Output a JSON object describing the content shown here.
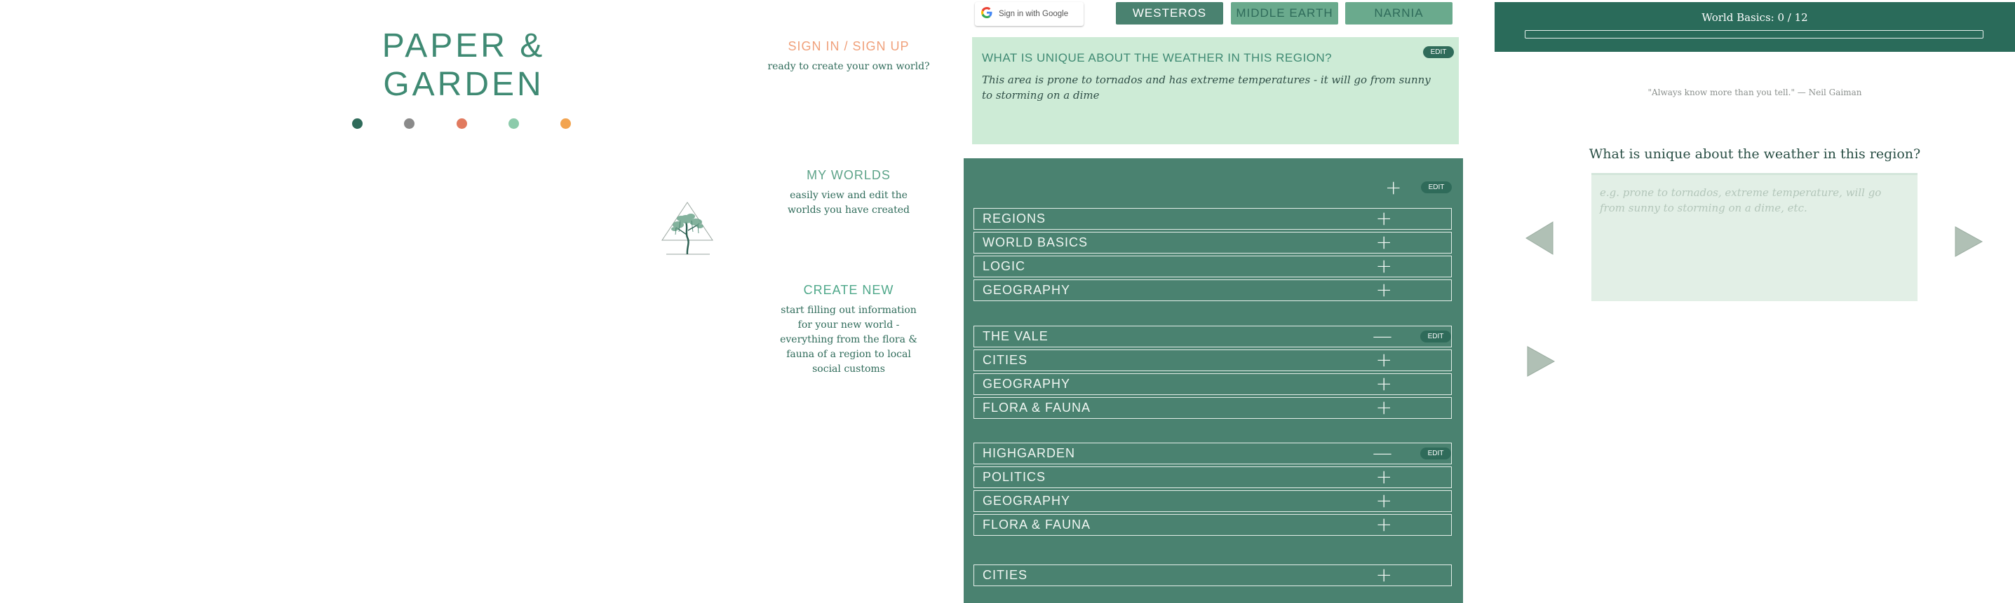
{
  "brand": {
    "title": "PAPER & GARDEN",
    "palette": [
      "#2f6b5a",
      "#8a8a8a",
      "#e17a5f",
      "#8ccbab",
      "#f2a450"
    ]
  },
  "landing": {
    "sign_in": {
      "heading": "SIGN IN / SIGN UP",
      "text": "ready to create your own world?",
      "color": "#f0a07a"
    },
    "my_worlds": {
      "heading": "MY WORLDS",
      "text": "easily view and edit the worlds you have created",
      "color": "#5da389"
    },
    "create_new": {
      "heading": "CREATE NEW",
      "text": "start filling out information for your new world - everything from the flora & fauna of a region to local social customs",
      "color": "#4fa88a"
    }
  },
  "editor": {
    "google_button": "Sign in with Google",
    "world_tabs": [
      {
        "label": "WESTEROS",
        "bg": "#4a8270",
        "color": "#ffffff"
      },
      {
        "label": "MIDDLE EARTH",
        "bg": "#6aaa8d",
        "color": "#2f6b5a"
      },
      {
        "label": "NARNIA",
        "bg": "#6aaa8d",
        "color": "#2f6b5a"
      }
    ],
    "question_card": {
      "question": "WHAT IS UNIQUE ABOUT THE WEATHER IN THIS REGION?",
      "answer": "This area is prone to tornados and has extreme temperatures - it will go from sunny to storming on a dime",
      "edit_label": "EDIT"
    },
    "edit_label": "EDIT",
    "top_toggle": "+",
    "sections": [
      {
        "label": "REGIONS",
        "toggle": "+"
      },
      {
        "label": "WORLD BASICS",
        "toggle": "+"
      },
      {
        "label": "LOGIC",
        "toggle": "+"
      },
      {
        "label": "GEOGRAPHY",
        "toggle": "+"
      },
      {
        "label": "THE VALE",
        "toggle": "—"
      },
      {
        "label": "CITIES",
        "toggle": "+"
      },
      {
        "label": "GEOGRAPHY",
        "toggle": "+"
      },
      {
        "label": "FLORA & FAUNA",
        "toggle": "+"
      },
      {
        "label": "HIGHGARDEN",
        "toggle": "—"
      },
      {
        "label": "POLITICS",
        "toggle": "+"
      },
      {
        "label": "GEOGRAPHY",
        "toggle": "+"
      },
      {
        "label": "FLORA & FAUNA",
        "toggle": "+"
      },
      {
        "label": "CITIES",
        "toggle": "+"
      }
    ]
  },
  "wizard": {
    "progress_label": "World Basics: 0 / 12",
    "progress_value": 0,
    "quote": "\"Always know more than you tell.\" — Neil Gaiman",
    "question": "What is unique about the weather in this region?",
    "answer_placeholder": "e.g. prone to tornados, extreme temperature, will go from sunny to storming on a dime, etc.",
    "answer_value": ""
  }
}
